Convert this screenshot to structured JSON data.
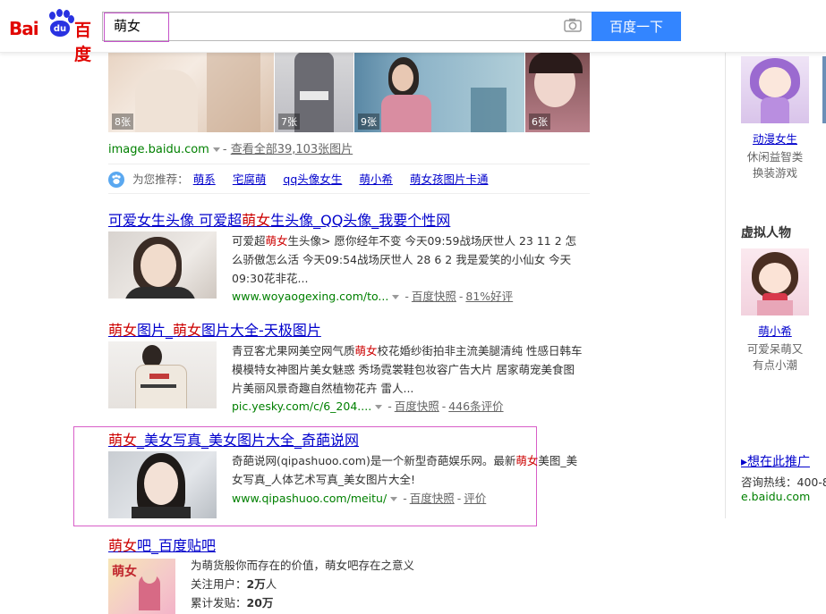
{
  "header": {
    "logo_text": "Bai",
    "logo_du": "du",
    "logo_cn": "百度",
    "query": "萌女",
    "search_button": "百度一下"
  },
  "image_strip": {
    "counts": [
      "8张",
      "7张",
      "9张",
      "6张"
    ],
    "source": "image.baidu.com",
    "view_all": "查看全部39,103张图片"
  },
  "recommend": {
    "label": "为您推荐：",
    "items": [
      "萌系",
      "宅腐萌",
      "qq头像女生",
      "萌小希",
      "萌女孩图片卡通"
    ]
  },
  "results": [
    {
      "title_pre": "可爱女生头像 可爱超",
      "title_em": "萌女",
      "title_post": "生头像_QQ头像_我要个性网",
      "abstract_pre": "可爱超",
      "abstract_em": "萌女",
      "abstract_post": "生头像> 愿你经年不变 今天09:59战场厌世人 23 11 2 怎么骄傲怎么活 今天09:54战场厌世人 28 6 2 我是爱笑的小仙女 今天09:30花非花...",
      "url": "www.woyaogexing.com/to...",
      "snapshot": "百度快照",
      "rating": "81%好评"
    },
    {
      "title_em1": "萌女",
      "title_mid": "图片_",
      "title_em2": "萌女",
      "title_post": "图片大全-天极图片",
      "abstract_pre": "青豆客尤果网美空网气质",
      "abstract_em": "萌女",
      "abstract_post": "校花婚纱街拍非主流美腿清纯 性感日韩车模模特女神图片美女魅惑 秀场霓裳鞋包妆容广告大片 居家萌宠美食图片美丽风景奇趣自然植物花卉 雷人...",
      "url": "pic.yesky.com/c/6_204....",
      "snapshot": "百度快照",
      "rating": "446条评价"
    },
    {
      "title_em": "萌女",
      "title_post": "_美女写真_美女图片大全_奇葩说网",
      "abstract_pre": "奇葩说网(qipashuoo.com)是一个新型奇葩娱乐网。最新",
      "abstract_em": "萌女",
      "abstract_post": "美图_美女写真_人体艺术写真_美女图片大全!",
      "url": "www.qipashuoo.com/meitu/",
      "snapshot": "百度快照",
      "rating": "评价"
    },
    {
      "title_em": "萌女",
      "title_post": "吧_百度贴吧",
      "desc": "为萌货般你而存在的价值，萌女吧存在之意义",
      "followers_label": "关注用户：",
      "followers_value": "2万",
      "followers_unit": "人",
      "posts_label": "累计发贴：",
      "posts_value": "20万",
      "thumb_text": "萌女"
    }
  ],
  "sidebar": {
    "item1_name": "动漫女生",
    "item1_desc_1": "休闲益智类",
    "item1_desc_2": "换装游戏",
    "section_title": "虚拟人物",
    "item2_name": "萌小希",
    "item2_desc_1": "可爱呆萌又",
    "item2_desc_2": "有点小潮",
    "ad_title": "▸想在此推广",
    "ad_hotline": "咨询热线：400-8",
    "ad_url": "e.baidu.com"
  },
  "colors": {
    "link": "#0000cc",
    "highlight": "#cc0000",
    "url_green": "#008000",
    "button": "#3385ff",
    "annotation_box": "#c553c9"
  }
}
